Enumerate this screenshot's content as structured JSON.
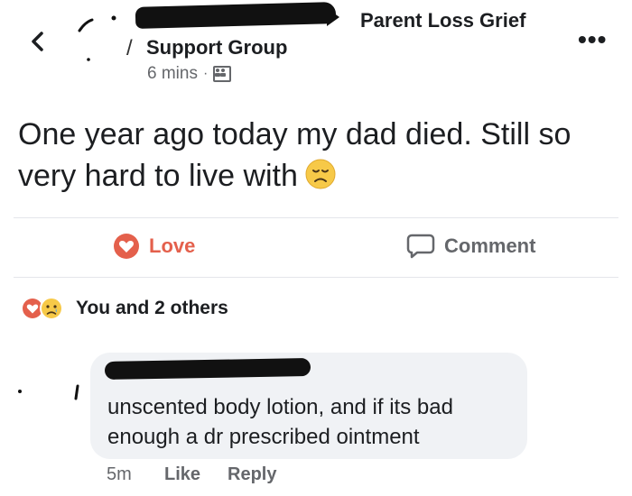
{
  "header": {
    "back_icon": "chevron-left-icon",
    "group_name_line1": "Parent Loss Grief",
    "group_name_line2": "Support Group",
    "timestamp": "6 mins",
    "separator": "·",
    "audience_icon": "group-icon",
    "more_icon": "•••"
  },
  "post": {
    "text": "One year ago today my dad died. Still so very hard to live with",
    "emoji": "disappointed-face"
  },
  "actions": {
    "love_label": "Love",
    "comment_label": "Comment",
    "love_color": "#e4604c"
  },
  "reactions": {
    "summary": "You and 2 others"
  },
  "comment": {
    "text": "unscented body lotion, and if its bad enough a dr prescribed ointment",
    "time": "5m",
    "like_label": "Like",
    "reply_label": "Reply"
  }
}
